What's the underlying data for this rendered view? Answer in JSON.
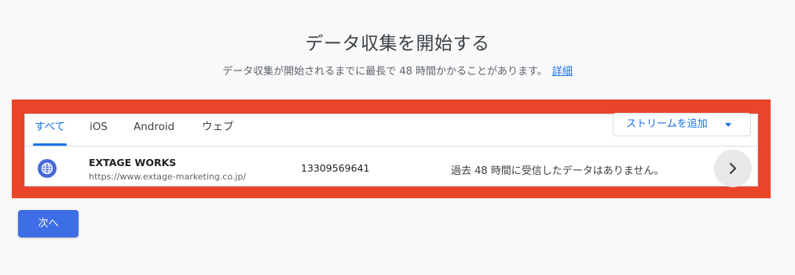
{
  "header": {
    "title": "データ収集を開始する",
    "subtitle": "データ収集が開始されるまでに最長で 48 時間かかることがあります。",
    "details_link": "詳細"
  },
  "tabs": [
    {
      "label": "すべて",
      "active": true
    },
    {
      "label": "iOS",
      "active": false
    },
    {
      "label": "Android",
      "active": false
    },
    {
      "label": "ウェブ",
      "active": false
    }
  ],
  "add_stream": {
    "label": "ストリームを追加",
    "icon": "chevron-down-icon"
  },
  "streams": [
    {
      "icon": "globe-icon",
      "name": "EXTAGE WORKS",
      "url": "https://www.extage-marketing.co.jp/",
      "id": "13309569641",
      "status": "過去 48 時間に受信したデータはありません。"
    }
  ],
  "footer": {
    "next_label": "次へ"
  },
  "colors": {
    "accent": "#1a73e8",
    "highlight": "#e8452a",
    "primary_button": "#3d6ee6"
  }
}
